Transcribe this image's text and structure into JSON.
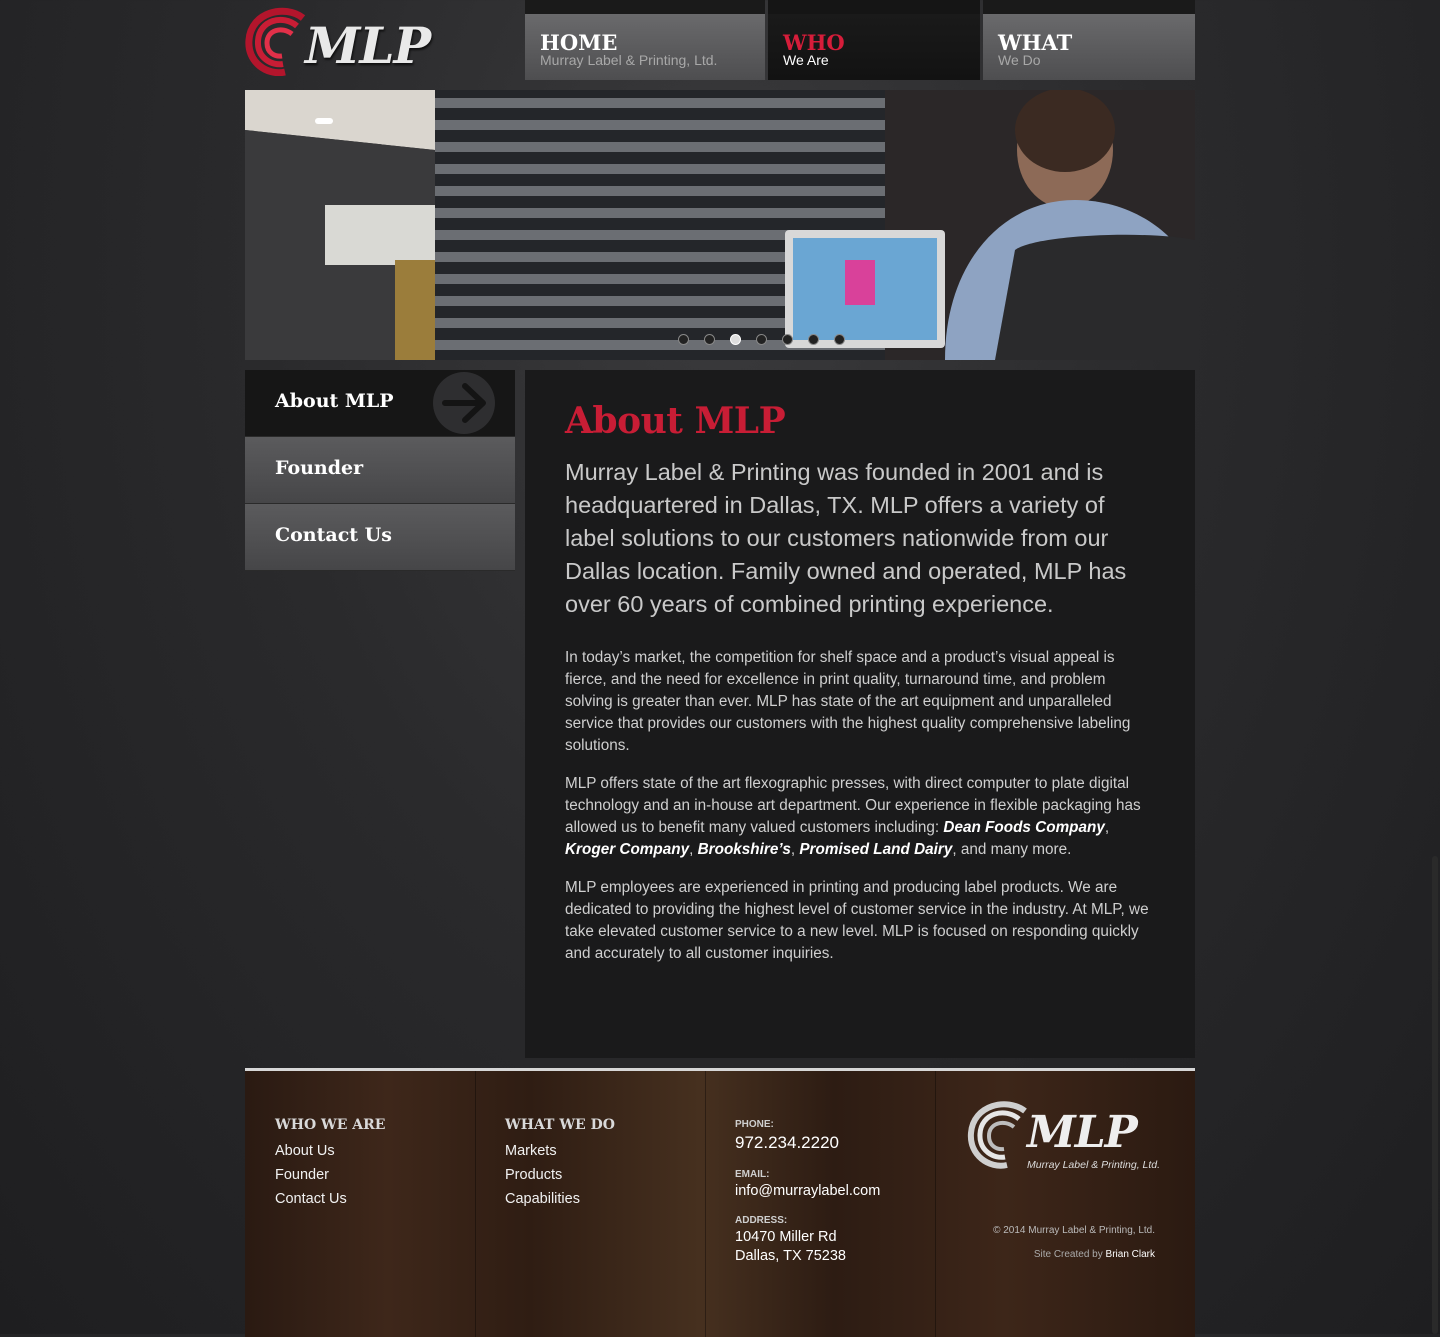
{
  "header": {
    "logo_text": "MLP",
    "nav": [
      {
        "title": "HOME",
        "sub": "Murray Label & Printing, Ltd."
      },
      {
        "title": "WHO",
        "sub": "We Are"
      },
      {
        "title": "WHAT",
        "sub": "We Do"
      }
    ]
  },
  "hero": {
    "slide_count": 7,
    "active_slide": 3
  },
  "sidebar": {
    "items": [
      {
        "label": "About MLP",
        "active": true
      },
      {
        "label": "Founder",
        "active": false
      },
      {
        "label": "Contact Us",
        "active": false
      }
    ],
    "arrow_icon": "arrow-right-icon"
  },
  "main": {
    "heading": "About MLP",
    "lead": "Murray Label & Printing was founded in 2001 and is headquartered in Dallas, TX. MLP offers a variety of label solutions to our customers nationwide from our Dallas location. Family owned and operated, MLP has over 60 years of combined printing experience.",
    "p1": "In today’s market, the competition for shelf space and a product’s visual appeal is fierce, and the need for excellence in print quality, turnaround time, and problem solving is greater than ever. MLP has state of the art equipment and unparalleled service that provides our customers with the highest quality comprehensive labeling solutions.",
    "p2_before": "MLP offers state of the art flexographic presses, with direct computer to plate digital technology and an in-house art department. Our experience in flexible packaging has allowed us to benefit many valued customers including: ",
    "p2_c1": "Dean Foods Company",
    "p2_c2": "Kroger Company",
    "p2_c3": "Brookshire’s",
    "p2_c4": "Promised Land Dairy",
    "p2_after": ", and many more.",
    "p3": "MLP employees are experienced in printing and producing label products. We are dedicated to providing the highest level of customer service in the industry. At MLP, we take elevated customer service to a new level. MLP is focused on responding quickly and accurately to all customer inquiries."
  },
  "footer": {
    "who": {
      "title": "WHO WE ARE",
      "links": [
        "About Us",
        "Founder",
        "Contact Us"
      ]
    },
    "what": {
      "title": "WHAT WE DO",
      "links": [
        "Markets",
        "Products",
        "Capabilities"
      ]
    },
    "contact": {
      "phone_label": "PHONE:",
      "phone": "972.234.2220",
      "email_label": "EMAIL:",
      "email": "info@murraylabel.com",
      "address_label": "ADDRESS:",
      "address_line1": "10470 Miller Rd",
      "address_line2": "Dallas, TX 75238"
    },
    "logo_text": "MLP",
    "logo_sub": "Murray Label & Printing, Ltd.",
    "copyright": "© 2014 Murray Label & Printing, Ltd.",
    "credit_prefix": "Site Created by",
    "credit_name": "Brian Clark"
  },
  "colors": {
    "accent": "#c81d35",
    "nav_active_bg": "#151515"
  }
}
